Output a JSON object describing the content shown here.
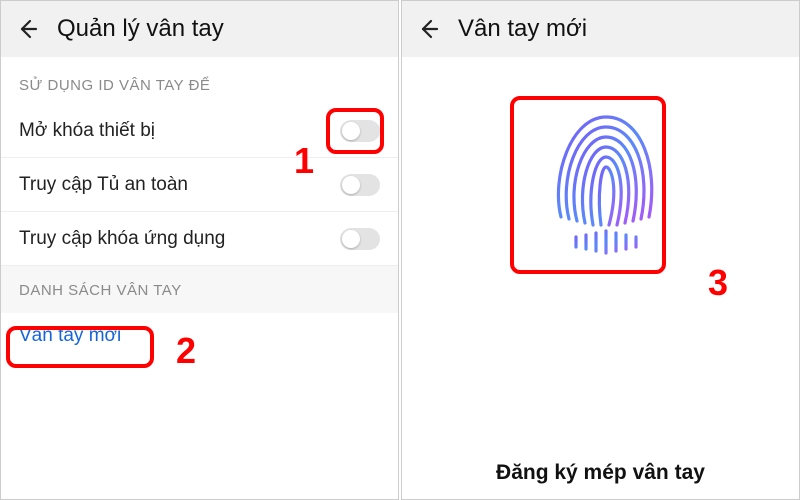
{
  "left": {
    "header_title": "Quản lý vân tay",
    "section1_title": "SỬ DỤNG ID VÂN TAY ĐỂ",
    "rows": [
      {
        "label": "Mở khóa thiết bị"
      },
      {
        "label": "Truy cập Tủ an toàn"
      },
      {
        "label": "Truy cập khóa ứng dụng"
      }
    ],
    "section2_title": "DANH SÁCH VÂN TAY",
    "new_fp_label": "Vân tay mới"
  },
  "right": {
    "header_title": "Vân tay mới",
    "caption": "Đăng ký mép vân tay"
  },
  "annotations": {
    "n1": "1",
    "n2": "2",
    "n3": "3"
  }
}
